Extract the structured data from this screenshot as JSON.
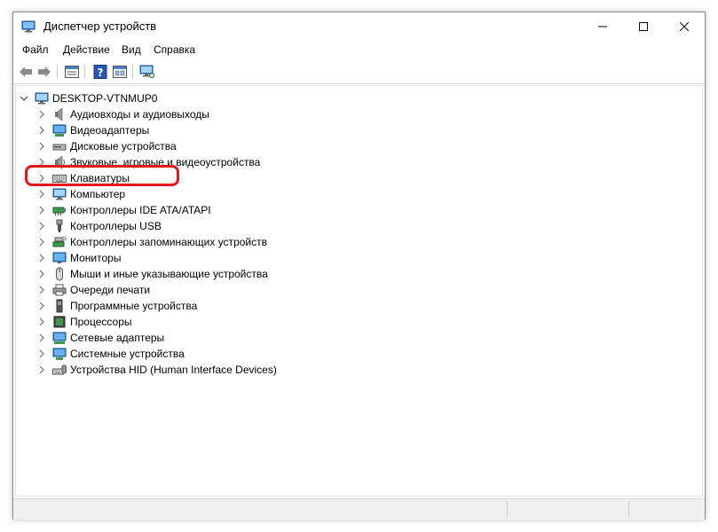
{
  "window": {
    "title": "Диспетчер устройств"
  },
  "menu": [
    {
      "label": "Файл"
    },
    {
      "label": "Действие"
    },
    {
      "label": "Вид"
    },
    {
      "label": "Справка"
    }
  ],
  "tree": {
    "root": "DESKTOP-VTNMUP0",
    "items": [
      {
        "label": "Аудиовходы и аудиовыходы",
        "icon": "speaker-icon"
      },
      {
        "label": "Видеоадаптеры",
        "icon": "display-adapter-icon"
      },
      {
        "label": "Дисковые устройства",
        "icon": "disk-drive-icon"
      },
      {
        "label": "Звуковые, игровые и видеоустройства",
        "icon": "sound-device-icon"
      },
      {
        "label": "Клавиатуры",
        "icon": "keyboard-icon"
      },
      {
        "label": "Компьютер",
        "icon": "computer-icon"
      },
      {
        "label": "Контроллеры IDE ATA/ATAPI",
        "icon": "ide-controller-icon"
      },
      {
        "label": "Контроллеры USB",
        "icon": "usb-icon"
      },
      {
        "label": "Контроллеры запоминающих устройств",
        "icon": "storage-controller-icon"
      },
      {
        "label": "Мониторы",
        "icon": "monitor-icon"
      },
      {
        "label": "Мыши и иные указывающие устройства",
        "icon": "mouse-icon"
      },
      {
        "label": "Очереди печати",
        "icon": "printer-icon"
      },
      {
        "label": "Программные устройства",
        "icon": "software-device-icon"
      },
      {
        "label": "Процессоры",
        "icon": "processor-icon"
      },
      {
        "label": "Сетевые адаптеры",
        "icon": "network-adapter-icon"
      },
      {
        "label": "Системные устройства",
        "icon": "system-device-icon"
      },
      {
        "label": "Устройства HID (Human Interface Devices)",
        "icon": "hid-icon"
      }
    ]
  },
  "colors": {
    "highlight": "#e8141c",
    "accent": "#1e73c8"
  }
}
